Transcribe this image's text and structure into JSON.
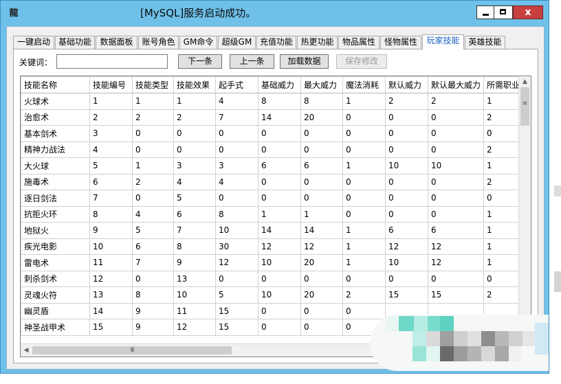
{
  "window": {
    "title": "[MySQL]服务启动成功。",
    "icon": "app-logo-icon",
    "icon_glyph": "龍",
    "close_glyph": "x"
  },
  "tabs": [
    {
      "label": "一键启动"
    },
    {
      "label": "基础功能"
    },
    {
      "label": "数据面板"
    },
    {
      "label": "账号角色"
    },
    {
      "label": "GM命令"
    },
    {
      "label": "超级GM"
    },
    {
      "label": "充值功能"
    },
    {
      "label": "热更功能"
    },
    {
      "label": "物品属性"
    },
    {
      "label": "怪物属性"
    },
    {
      "label": "玩家技能",
      "active": true
    },
    {
      "label": "英雄技能"
    }
  ],
  "toolbar": {
    "keyword_label": "关键词：",
    "keyword_value": "",
    "next_label": "下一条",
    "prev_label": "上一条",
    "load_label": "加载数据",
    "save_label": "保存修改"
  },
  "grid": {
    "columns": [
      "技能名称",
      "技能编号",
      "技能类型",
      "技能效果",
      "起手式",
      "基础威力",
      "最大威力",
      "魔法消耗",
      "默认威力",
      "默认最大威力",
      "所需职业"
    ],
    "rows": [
      [
        "火球术",
        "1",
        "1",
        "1",
        "4",
        "8",
        "8",
        "1",
        "2",
        "2",
        "1"
      ],
      [
        "治愈术",
        "2",
        "2",
        "2",
        "7",
        "14",
        "20",
        "0",
        "0",
        "0",
        "2"
      ],
      [
        "基本剑术",
        "3",
        "0",
        "0",
        "0",
        "0",
        "0",
        "0",
        "0",
        "0",
        "0"
      ],
      [
        "精神力战法",
        "4",
        "0",
        "0",
        "0",
        "0",
        "0",
        "0",
        "0",
        "0",
        "2"
      ],
      [
        "大火球",
        "5",
        "1",
        "3",
        "3",
        "6",
        "6",
        "1",
        "10",
        "10",
        "1"
      ],
      [
        "施毒术",
        "6",
        "2",
        "4",
        "4",
        "0",
        "0",
        "0",
        "0",
        "0",
        "2"
      ],
      [
        "逐日剑法",
        "7",
        "0",
        "5",
        "0",
        "0",
        "0",
        "0",
        "0",
        "0",
        "0"
      ],
      [
        "抗拒火环",
        "8",
        "4",
        "6",
        "8",
        "1",
        "1",
        "0",
        "0",
        "0",
        "1"
      ],
      [
        "地狱火",
        "9",
        "5",
        "7",
        "10",
        "14",
        "14",
        "1",
        "6",
        "6",
        "1"
      ],
      [
        "疾光电影",
        "10",
        "6",
        "8",
        "30",
        "12",
        "12",
        "1",
        "12",
        "12",
        "1"
      ],
      [
        "雷电术",
        "11",
        "7",
        "9",
        "12",
        "10",
        "20",
        "1",
        "10",
        "12",
        "1"
      ],
      [
        "刺杀剑术",
        "12",
        "0",
        "13",
        "0",
        "0",
        "0",
        "0",
        "0",
        "0",
        "0"
      ],
      [
        "灵魂火符",
        "13",
        "8",
        "10",
        "5",
        "10",
        "20",
        "2",
        "15",
        "15",
        "2"
      ],
      [
        "幽灵盾",
        "14",
        "9",
        "11",
        "15",
        "0",
        "0",
        "0",
        "",
        "",
        ""
      ],
      [
        "神圣战甲术",
        "15",
        "9",
        "12",
        "15",
        "0",
        "0",
        "0",
        "",
        "",
        ""
      ]
    ]
  },
  "scrollbars": {
    "up_arrow": "▲",
    "left_arrow": "◀",
    "v_grip": "≡",
    "h_grip": "III"
  },
  "colors": {
    "window_frame": "#6fc1ea",
    "close_button": "#c74040",
    "active_tab_text": "#1a5fc0"
  }
}
